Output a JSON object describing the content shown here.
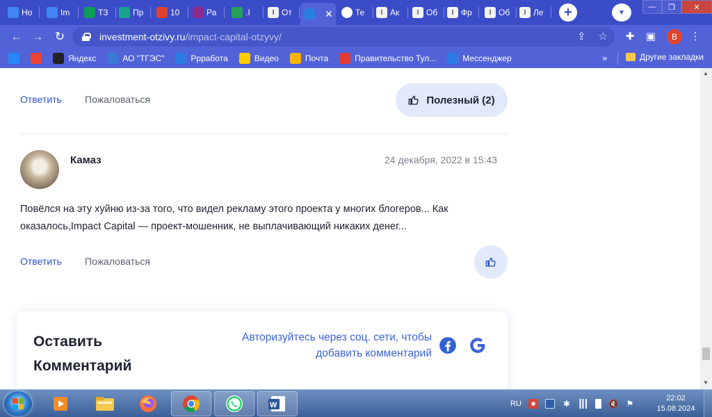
{
  "browser": {
    "tabs": [
      {
        "label": "Но",
        "icon": "docs-icon",
        "color": "#4285f4"
      },
      {
        "label": "Im",
        "icon": "docs-icon",
        "color": "#4285f4"
      },
      {
        "label": "ТЗ",
        "icon": "sheets-icon",
        "color": "#0f9d58"
      },
      {
        "label": "Пр",
        "icon": "m-icon",
        "color": "#1aa38c"
      },
      {
        "label": "10",
        "icon": "c-icon",
        "color": "#e04030"
      },
      {
        "label": "Ра",
        "icon": "p-icon",
        "color": "#8c2a8c"
      },
      {
        "label": ".I",
        "icon": "dots-icon",
        "color": "#23a05a"
      },
      {
        "label": "От",
        "icon": "i-icon",
        "color": "#777777"
      },
      {
        "label": "",
        "icon": "chart-icon",
        "color": "#2e7de0",
        "active": true
      },
      {
        "label": "Те",
        "icon": "globe-icon",
        "color": "#ffffff"
      },
      {
        "label": "Ак",
        "icon": "i-icon",
        "color": "#777777"
      },
      {
        "label": "Об",
        "icon": "i-icon",
        "color": "#777777"
      },
      {
        "label": "Фр",
        "icon": "i-icon",
        "color": "#777777"
      },
      {
        "label": "Об",
        "icon": "i-icon",
        "color": "#777777"
      },
      {
        "label": "Ле",
        "icon": "i-icon",
        "color": "#777777"
      }
    ],
    "url_host": "investment-otzivy.ru",
    "url_path": "/impact-capital-otzyvy/",
    "profile_letter": "B",
    "bookmarks": [
      {
        "label": "",
        "icon": "vk-icon",
        "color": "#2787f5"
      },
      {
        "label": "",
        "icon": "gmail-icon",
        "color": "#ea4335"
      },
      {
        "label": "Яндекс",
        "icon": "yandex-icon",
        "color": "#222222"
      },
      {
        "label": "АО \"ТГЭС\"",
        "icon": "tges-icon",
        "color": "#3a7bd5"
      },
      {
        "label": "Ррработа",
        "icon": "chat-icon",
        "color": "#2d7be5"
      },
      {
        "label": "Видео",
        "icon": "play-icon",
        "color": "#ffcc00"
      },
      {
        "label": "Почта",
        "icon": "mail-icon",
        "color": "#f6b300"
      },
      {
        "label": "Правительство Тул...",
        "icon": "gov-icon",
        "color": "#e53935"
      },
      {
        "label": "Мессенджер",
        "icon": "chat-icon",
        "color": "#2d7be5"
      }
    ],
    "bookmarks_more": "»",
    "other_bookmarks": "Другие закладки"
  },
  "comment_prev": {
    "reply_label": "Ответить",
    "complain_label": "Пожаловаться",
    "useful_label": "Полезный (2)"
  },
  "comment": {
    "author": "Камаз",
    "date": "24 декабря, 2022 в 15:43",
    "text_line1": "Повёлся на эту хуйню из-за того, что видел рекламу этого проекта у многих блогеров... Как",
    "text_line2": "оказалось,Impact Capital — проект-мошенник, не выплачивающий никаких денег...",
    "reply_label": "Ответить",
    "complain_label": "Пожаловаться"
  },
  "leave_comment": {
    "title_line1": "Оставить",
    "title_line2": "Комментарий",
    "auth_line1": "Авторизуйтесь через соц. сети, чтобы",
    "auth_line2": "добавить комментарий",
    "socials": [
      "facebook-icon",
      "google-icon"
    ]
  },
  "taskbar": {
    "apps": [
      "media-player-icon",
      "explorer-icon",
      "firefox-icon",
      "chrome-icon",
      "whatsapp-icon",
      "word-icon"
    ],
    "lang": "RU",
    "time": "22:02",
    "date": "15.08.2024"
  },
  "colors": {
    "chrome_dark": "#3b4cc8",
    "chrome": "#5263d8",
    "link_blue": "#2b52c9",
    "accent_bg": "#e1e9fb"
  }
}
